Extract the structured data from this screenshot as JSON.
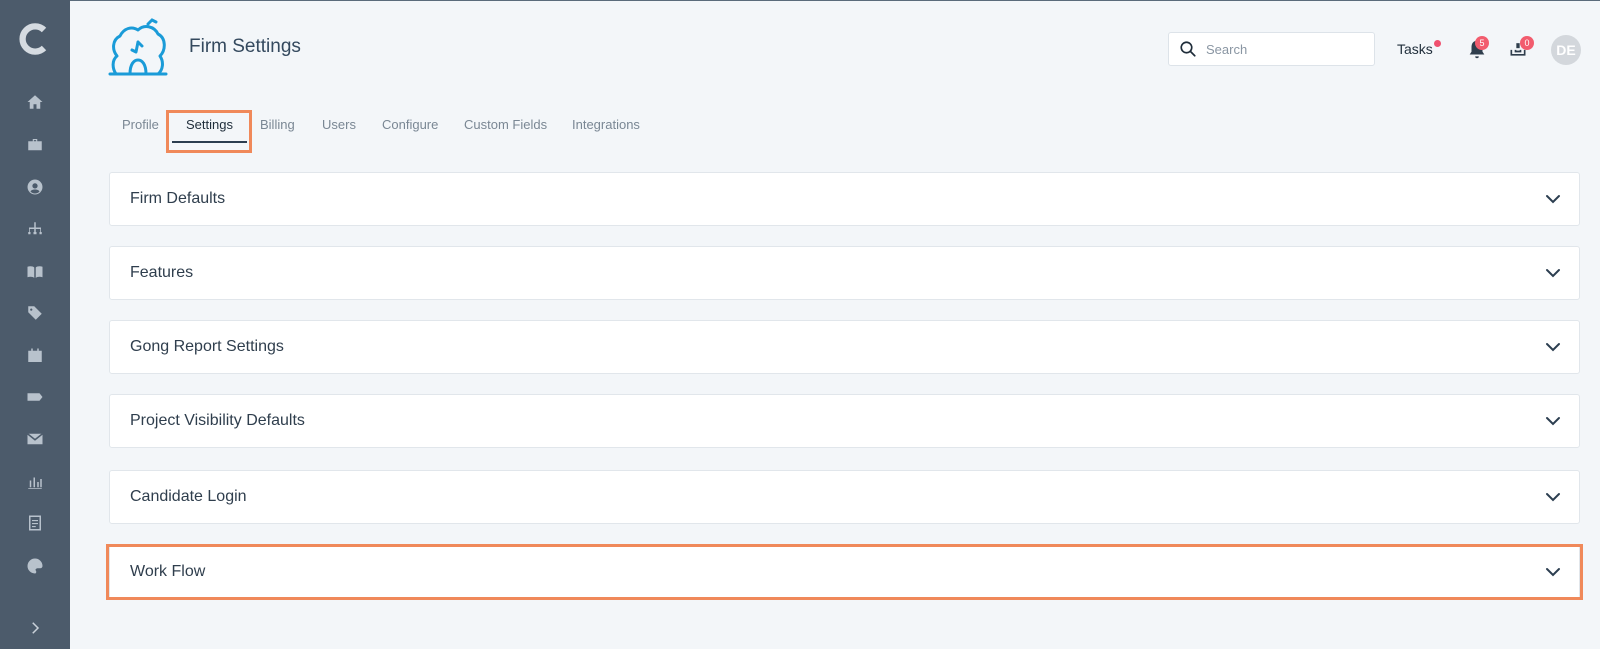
{
  "header": {
    "title": "Firm Settings",
    "search_placeholder": "Search",
    "tasks_label": "Tasks",
    "notifications_count": "5",
    "inbox_count": "0",
    "avatar_initials": "DE"
  },
  "tabs": [
    {
      "label": "Profile"
    },
    {
      "label": "Settings",
      "active": true
    },
    {
      "label": "Billing"
    },
    {
      "label": "Users"
    },
    {
      "label": "Configure"
    },
    {
      "label": "Custom Fields"
    },
    {
      "label": "Integrations"
    }
  ],
  "panels": [
    {
      "title": "Firm Defaults"
    },
    {
      "title": "Features"
    },
    {
      "title": "Gong Report Settings"
    },
    {
      "title": "Project Visibility Defaults"
    },
    {
      "title": "Candidate Login"
    },
    {
      "title": "Work Flow"
    }
  ],
  "sidebar": {
    "items": [
      "home-icon",
      "briefcase-icon",
      "user-circle-icon",
      "org-chart-icon",
      "book-icon",
      "tags-icon",
      "calendar-icon",
      "ticket-icon",
      "mail-icon",
      "bar-chart-icon",
      "document-icon",
      "palette-icon"
    ],
    "expand_icon": "chevron-right-icon"
  },
  "colors": {
    "sidebar": "#4c5b6b",
    "background": "#f3f6f9",
    "highlight": "#f0895a",
    "badge": "#f25c6e",
    "brand_logo": "#1a9bd8"
  }
}
